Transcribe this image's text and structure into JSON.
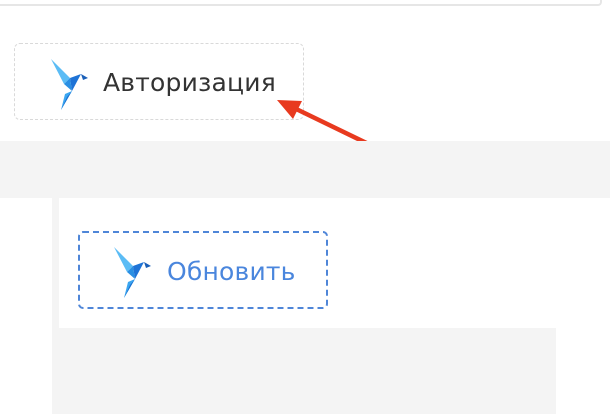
{
  "auth_button": {
    "label": "Авторизация",
    "icon": "bird-logo-icon"
  },
  "refresh_button": {
    "label": "Обновить",
    "icon": "bird-logo-icon"
  },
  "annotation": {
    "icon": "red-arrow-icon",
    "color": "#e83a1f"
  },
  "colors": {
    "bird_light": "#3aa6f0",
    "bird_dark": "#1b6fd0",
    "refresh_accent": "#4a86dd",
    "panel_gray": "#f4f4f4"
  }
}
